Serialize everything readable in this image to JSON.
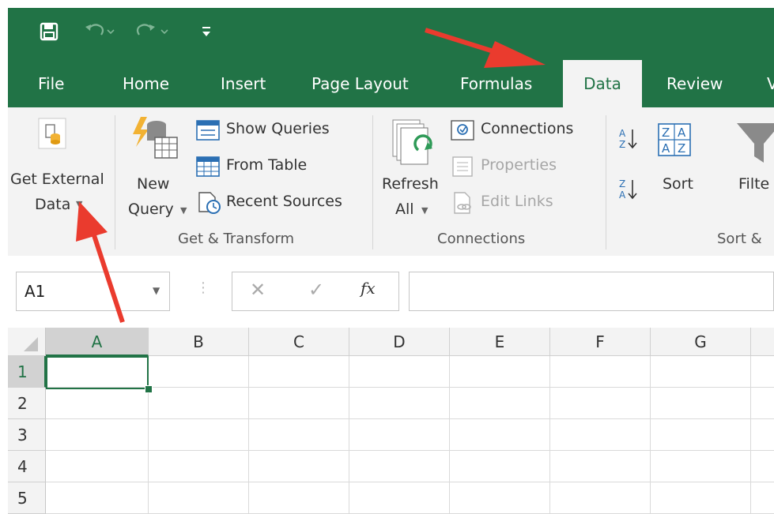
{
  "quick_access": {
    "save": "save-icon",
    "undo": "undo-icon",
    "redo": "redo-icon",
    "customize": "customize-qat-icon"
  },
  "tabs": {
    "file": "File",
    "home": "Home",
    "insert": "Insert",
    "page_layout": "Page Layout",
    "formulas": "Formulas",
    "data": "Data",
    "review": "Review",
    "view_partial": "V"
  },
  "ribbon": {
    "get_external": {
      "line1": "Get External",
      "line2": "Data"
    },
    "new_query": {
      "line1": "New",
      "line2": "Query"
    },
    "show_queries": "Show Queries",
    "from_table": "From Table",
    "recent_sources": "Recent Sources",
    "get_transform_label": "Get & Transform",
    "refresh": {
      "line1": "Refresh",
      "line2": "All"
    },
    "connections": "Connections",
    "properties": "Properties",
    "edit_links": "Edit Links",
    "connections_label": "Connections",
    "sort": "Sort",
    "filter_partial": "Filte",
    "sort_filter_label": "Sort &"
  },
  "formula_bar": {
    "name_box": "A1",
    "fx": "fx",
    "value": ""
  },
  "columns": [
    "A",
    "B",
    "C",
    "D",
    "E",
    "F",
    "G"
  ],
  "rows": [
    "1",
    "2",
    "3",
    "4",
    "5"
  ],
  "colors": {
    "excel_green": "#217346",
    "annotation_arrow": "#ea3b2e"
  }
}
